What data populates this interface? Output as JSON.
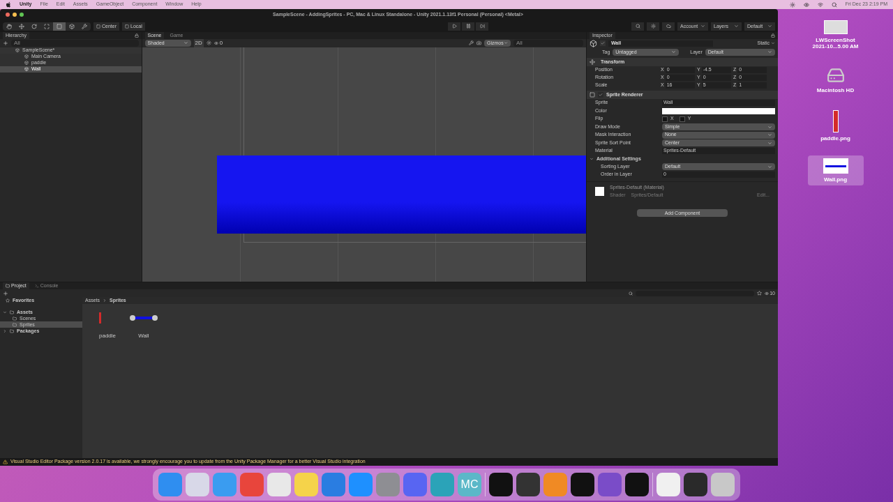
{
  "menubar": {
    "app": "Unity",
    "items": [
      "File",
      "Edit",
      "Assets",
      "GameObject",
      "Component",
      "Window",
      "Help"
    ],
    "clock": "Fri Dec 23  2:19 PM"
  },
  "window": {
    "title": "SampleScene - AddingSprites - PC, Mac & Linux Standalone - Unity 2021.1.13f1 Personal (Personal) <Metal>"
  },
  "toolbar": {
    "tools": [
      {
        "kind": "hand",
        "selected": false
      },
      {
        "kind": "move",
        "selected": false
      },
      {
        "kind": "rotate",
        "selected": false
      },
      {
        "kind": "scale",
        "selected": false
      },
      {
        "kind": "rect",
        "selected": true
      },
      {
        "kind": "transform",
        "selected": false
      },
      {
        "kind": "custom",
        "selected": false
      }
    ],
    "pivot": [
      "Center",
      "Local"
    ],
    "right": [
      "Account",
      "Layers",
      "Default"
    ]
  },
  "hierarchy": {
    "title": "Hierarchy",
    "search": {
      "placeholder": "All"
    },
    "scene": "SampleScene*",
    "items": [
      {
        "label": "Main Camera",
        "selected": false
      },
      {
        "label": "paddle",
        "selected": false
      },
      {
        "label": "Wall",
        "selected": true
      }
    ]
  },
  "scene_view": {
    "tabs": [
      {
        "label": "Scene",
        "selected": true
      },
      {
        "label": "Game",
        "selected": false
      }
    ],
    "shading": "Shaded",
    "mode": "2D",
    "layers": "0",
    "gizmos": "Gizmos",
    "search": {
      "placeholder": "All"
    }
  },
  "inspector": {
    "title": "Inspector",
    "object": {
      "name": "Wall",
      "active": true,
      "static": "Static",
      "tag_label": "Tag",
      "tag": "Untagged",
      "layer_label": "Layer",
      "layer": "Default"
    },
    "transform": {
      "title": "Transform",
      "rows": [
        {
          "label": "Position",
          "values": [
            {
              "axis": "X",
              "value": "0"
            },
            {
              "axis": "Y",
              "value": "-4.5"
            },
            {
              "axis": "Z",
              "value": "0"
            }
          ]
        },
        {
          "label": "Rotation",
          "values": [
            {
              "axis": "X",
              "value": "0"
            },
            {
              "axis": "Y",
              "value": "0"
            },
            {
              "axis": "Z",
              "value": "0"
            }
          ]
        },
        {
          "label": "Scale",
          "values": [
            {
              "axis": "X",
              "value": "16"
            },
            {
              "axis": "Y",
              "value": "5"
            },
            {
              "axis": "Z",
              "value": "1"
            }
          ]
        }
      ]
    },
    "sprite_renderer": {
      "title": "Sprite Renderer",
      "enabled": true,
      "fields": [
        {
          "label": "Sprite",
          "kind": "object",
          "value": "Wall"
        },
        {
          "label": "Color",
          "kind": "color",
          "color": "#ffffff"
        },
        {
          "label": "Flip",
          "kind": "flip",
          "options": [
            {
              "label": "X",
              "checked": false
            },
            {
              "label": "Y",
              "checked": false
            }
          ]
        },
        {
          "label": "Draw Mode",
          "kind": "dropdown",
          "value": "Simple"
        },
        {
          "label": "Mask Interaction",
          "kind": "dropdown",
          "value": "None"
        },
        {
          "label": "Sprite Sort Point",
          "kind": "dropdown",
          "value": "Center"
        },
        {
          "label": "Material",
          "kind": "object",
          "value": "Sprites-Default"
        }
      ],
      "additional": {
        "title": "Additional Settings",
        "expanded": true,
        "fields": [
          {
            "label": "Sorting Layer",
            "kind": "dropdown",
            "value": "Default"
          },
          {
            "label": "Order in Layer",
            "kind": "number",
            "value": "0"
          }
        ]
      }
    },
    "material": {
      "name": "Sprites-Default (Material)",
      "shader_label": "Shader",
      "shader": "Sprites/Default",
      "edit": "Edit..."
    },
    "add_component": "Add Component"
  },
  "project": {
    "tabs": [
      {
        "label": "Project",
        "selected": true
      },
      {
        "label": "Console",
        "selected": false
      }
    ],
    "favorites": "Favorites",
    "tree": [
      {
        "label": "Assets",
        "expanded": true,
        "selected": false,
        "children": [
          {
            "label": "Scenes",
            "selected": false
          },
          {
            "label": "Sprites",
            "selected": true
          }
        ]
      },
      {
        "label": "Packages",
        "expanded": false,
        "selected": false
      }
    ],
    "breadcrumb": [
      "Assets",
      "Sprites"
    ],
    "count": "10",
    "assets": [
      {
        "label": "paddle",
        "kind": "bar",
        "color": "#d42a2a"
      },
      {
        "label": "Wall",
        "kind": "line",
        "color": "#1010e0"
      }
    ]
  },
  "status": "Visual Studio Editor Package version 2.0.17 is available, we strongly encourage you to update from the Unity Package Manager for a better Visual Studio integration",
  "desktop": [
    {
      "label": "LWScreenShot 2021-10...5.00 AM",
      "kind": "screenshot",
      "selected": false
    },
    {
      "label": "Macintosh HD",
      "kind": "disk",
      "selected": false
    },
    {
      "label": "paddle.png",
      "kind": "paddle",
      "selected": false
    },
    {
      "label": "Wall.png",
      "kind": "wall",
      "selected": true
    }
  ],
  "dock": [
    {
      "kind": "app",
      "color": "#2f8ef0"
    },
    {
      "kind": "app",
      "color": "#d8d8e8"
    },
    {
      "kind": "app",
      "color": "#3a9cf0"
    },
    {
      "kind": "app",
      "color": "#e8453c"
    },
    {
      "kind": "app",
      "color": "#e8e8e8"
    },
    {
      "kind": "app",
      "color": "#f5d34a"
    },
    {
      "kind": "app",
      "color": "#2a7de1"
    },
    {
      "kind": "app",
      "color": "#1e90ff"
    },
    {
      "kind": "app",
      "color": "#8e8e93"
    },
    {
      "kind": "app",
      "color": "#5865f2"
    },
    {
      "kind": "app",
      "color": "#2ba3b8"
    },
    {
      "kind": "text",
      "label": "MC",
      "color": "#5bb8c8"
    },
    {
      "kind": "sep"
    },
    {
      "kind": "app",
      "color": "#111111"
    },
    {
      "kind": "app",
      "color": "#333333"
    },
    {
      "kind": "app",
      "color": "#f08a24"
    },
    {
      "kind": "app",
      "color": "#111111"
    },
    {
      "kind": "app",
      "color": "#7a4cc8"
    },
    {
      "kind": "app",
      "color": "#111111"
    },
    {
      "kind": "sep"
    },
    {
      "kind": "app",
      "color": "#f0f0f0"
    },
    {
      "kind": "app",
      "color": "#2a2a2a"
    },
    {
      "kind": "app",
      "color": "#c8c8c8"
    }
  ]
}
